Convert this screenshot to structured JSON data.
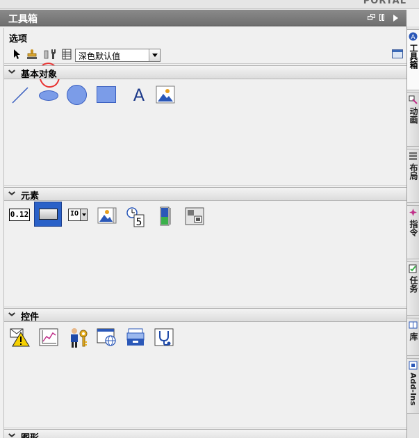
{
  "app": {
    "brand": "PORTAL"
  },
  "toolbox": {
    "title": "工具箱"
  },
  "options": {
    "label": "选项",
    "style_combo": {
      "value": "深色默认值"
    }
  },
  "groups": [
    {
      "title": "基本对象",
      "items": [
        "line-icon",
        "ellipse-icon",
        "circle-icon",
        "rectangle-icon",
        "text-field-icon",
        "graphic-view-icon"
      ]
    },
    {
      "title": "元素",
      "io_field_text": "0.12",
      "symbolic_io_text": "IO",
      "clock_text": "5"
    },
    {
      "title": "控件"
    },
    {
      "title": "图形"
    }
  ],
  "side_tabs": [
    {
      "label": "工具箱"
    },
    {
      "label": "动画"
    },
    {
      "label": "布局"
    },
    {
      "label": "指令"
    },
    {
      "label": "任务"
    },
    {
      "label": "库"
    },
    {
      "label": "Add-Ins"
    }
  ],
  "colors": {
    "title_bar": "#7a7a7a",
    "shape_fill": "#7b9ce8",
    "selection": "#2a61c8",
    "annotation": "#e8302f"
  }
}
